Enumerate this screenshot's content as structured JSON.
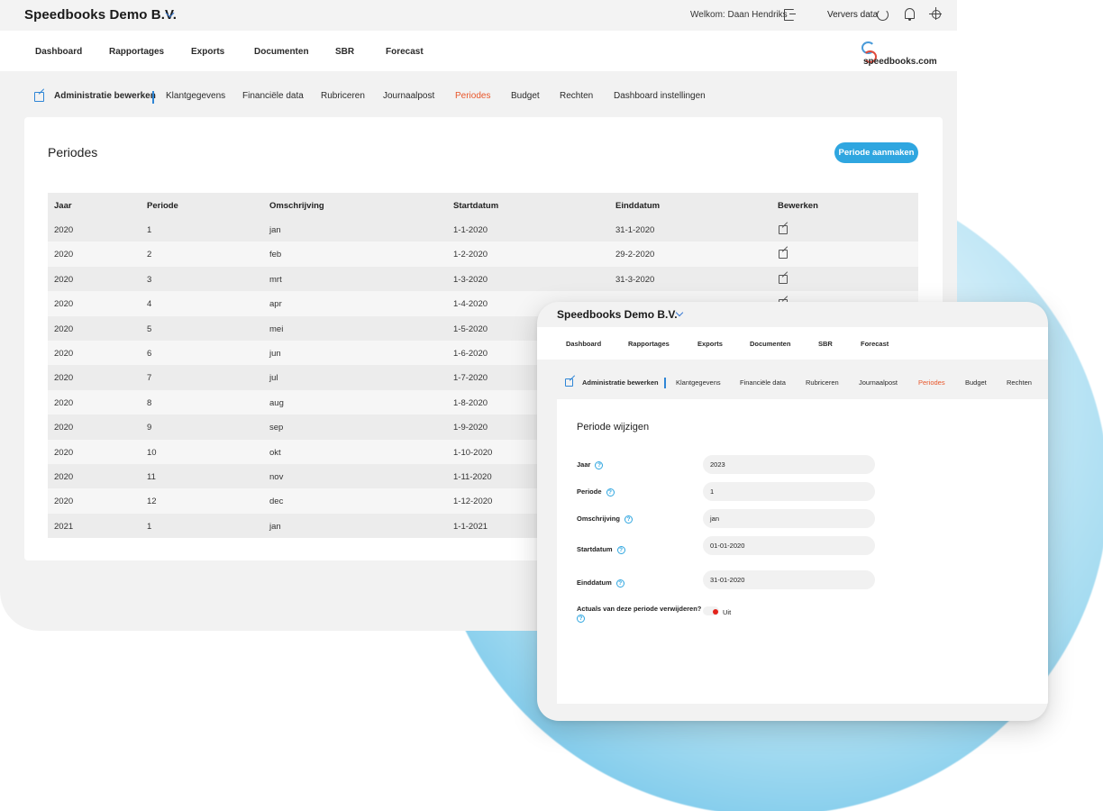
{
  "brand": {
    "accent": "#2fa6e0",
    "active_tab": "#e8562a",
    "toggle_off": "#e3231b"
  },
  "back": {
    "company": "Speedbooks Demo B.V.",
    "welcome": "Welkom: Daan Hendriks",
    "refresh_label": "Ververs data",
    "logo_text": "speedbooks.com",
    "nav": [
      "Dashboard",
      "Rapportages",
      "Exports",
      "Documenten",
      "SBR",
      "Forecast"
    ],
    "subnav": [
      "Administratie bewerken",
      "Klantgegevens",
      "Financiële data",
      "Rubriceren",
      "Journaalpost",
      "Periodes",
      "Budget",
      "Rechten",
      "Dashboard instellingen"
    ],
    "active_subnav": "Periodes",
    "page_title": "Periodes",
    "create_button": "Periode aanmaken",
    "table": {
      "headers": [
        "Jaar",
        "Periode",
        "Omschrijving",
        "Startdatum",
        "Einddatum",
        "Bewerken"
      ],
      "rows": [
        [
          "2020",
          "1",
          "jan",
          "1-1-2020",
          "31-1-2020"
        ],
        [
          "2020",
          "2",
          "feb",
          "1-2-2020",
          "29-2-2020"
        ],
        [
          "2020",
          "3",
          "mrt",
          "1-3-2020",
          "31-3-2020"
        ],
        [
          "2020",
          "4",
          "apr",
          "1-4-2020",
          ""
        ],
        [
          "2020",
          "5",
          "mei",
          "1-5-2020",
          ""
        ],
        [
          "2020",
          "6",
          "jun",
          "1-6-2020",
          ""
        ],
        [
          "2020",
          "7",
          "jul",
          "1-7-2020",
          ""
        ],
        [
          "2020",
          "8",
          "aug",
          "1-8-2020",
          ""
        ],
        [
          "2020",
          "9",
          "sep",
          "1-9-2020",
          ""
        ],
        [
          "2020",
          "10",
          "okt",
          "1-10-2020",
          ""
        ],
        [
          "2020",
          "11",
          "nov",
          "1-11-2020",
          ""
        ],
        [
          "2020",
          "12",
          "dec",
          "1-12-2020",
          ""
        ],
        [
          "2021",
          "1",
          "jan",
          "1-1-2021",
          ""
        ]
      ]
    }
  },
  "front": {
    "company": "Speedbooks Demo B.V.",
    "nav": [
      "Dashboard",
      "Rapportages",
      "Exports",
      "Documenten",
      "SBR",
      "Forecast"
    ],
    "subnav": [
      "Administratie bewerken",
      "Klantgegevens",
      "Financiële data",
      "Rubriceren",
      "Journaalpost",
      "Periodes",
      "Budget",
      "Rechten"
    ],
    "form_title": "Periode wijzigen",
    "fields": [
      {
        "label": "Jaar",
        "value": "2023"
      },
      {
        "label": "Periode",
        "value": "1"
      },
      {
        "label": "Omschrijving",
        "value": "jan"
      },
      {
        "label": "Startdatum",
        "value": "01-01-2020"
      },
      {
        "label": "Einddatum",
        "value": "31-01-2020"
      }
    ],
    "toggle_label": "Actuals van deze periode verwijderen?",
    "toggle_state": "Uit"
  }
}
